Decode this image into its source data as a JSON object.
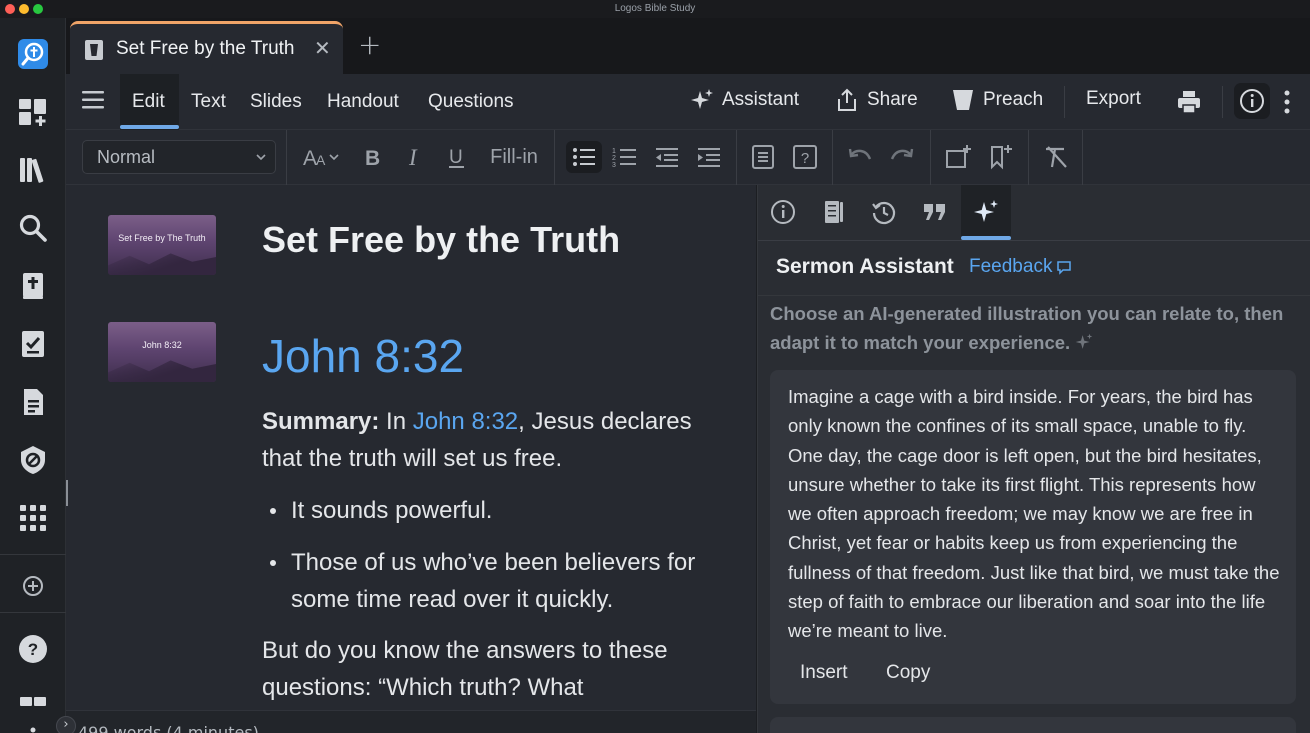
{
  "window": {
    "title": "Logos Bible Study"
  },
  "tab": {
    "title": "Set Free by the Truth",
    "close": "✕",
    "add": "+"
  },
  "menu": {
    "items": [
      "Edit",
      "Text",
      "Slides",
      "Handout",
      "Questions"
    ],
    "assistant": "Assistant",
    "share": "Share",
    "preach": "Preach",
    "export": "Export"
  },
  "format": {
    "style": "Normal",
    "fill_in": "Fill-in"
  },
  "document": {
    "slide1_caption": "Set Free by The Truth",
    "slide2_caption": "John 8:32",
    "title": "Set Free by the Truth",
    "reference": "John 8:32",
    "summary_label": "Summary:",
    "summary_pre": " In ",
    "summary_link": "John 8:32",
    "summary_post": ", Jesus declares that the truth will set us free.",
    "bullets": [
      "It sounds powerful.",
      "Those of us who’ve been believers for some time read over it quickly."
    ],
    "para2": "But do you know the answers to these questions: “Which truth? What"
  },
  "status": {
    "words": "499 words (4 minutes)"
  },
  "panel": {
    "heading": "Sermon Assistant",
    "feedback": "Feedback",
    "hint": "Choose an AI-generated illustration you can relate to, then adapt it to match your experience.",
    "card_text": "Imagine a cage with a bird inside. For years, the bird has only known the confines of its small space, unable to fly. One day, the cage door is left open, but the bird hesitates, unsure whether to take its first flight. This represents how we often approach freedom; we may know we are free in Christ, yet fear or habits keep us from experiencing the fullness of that freedom. Just like that bird, we must take the step of faith to embrace our liberation and soar into the life we’re meant to live.",
    "insert": "Insert",
    "copy": "Copy"
  },
  "colors": {
    "accent": "#6fa8e6",
    "link": "#5aa6f0",
    "tab_accent": "#f0a468",
    "logo": "#2f8be8"
  }
}
